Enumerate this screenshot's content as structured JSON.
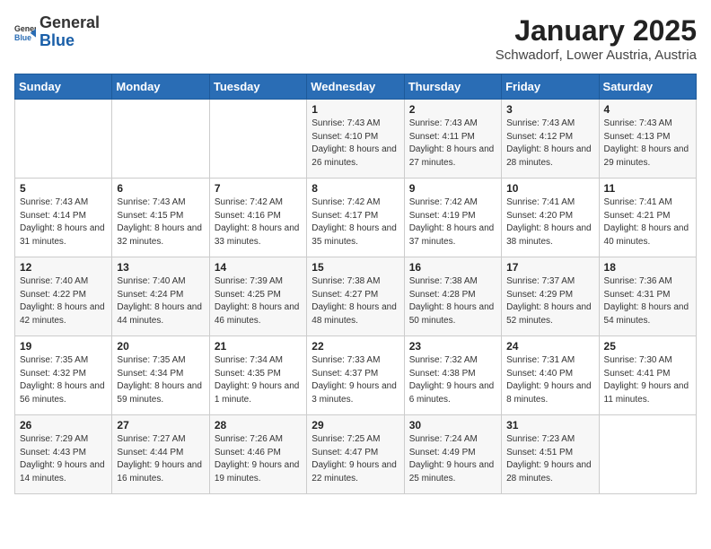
{
  "header": {
    "logo_general": "General",
    "logo_blue": "Blue",
    "month": "January 2025",
    "location": "Schwadorf, Lower Austria, Austria"
  },
  "days_of_week": [
    "Sunday",
    "Monday",
    "Tuesday",
    "Wednesday",
    "Thursday",
    "Friday",
    "Saturday"
  ],
  "weeks": [
    [
      {
        "day": "",
        "content": ""
      },
      {
        "day": "",
        "content": ""
      },
      {
        "day": "",
        "content": ""
      },
      {
        "day": "1",
        "content": "Sunrise: 7:43 AM\nSunset: 4:10 PM\nDaylight: 8 hours and 26 minutes."
      },
      {
        "day": "2",
        "content": "Sunrise: 7:43 AM\nSunset: 4:11 PM\nDaylight: 8 hours and 27 minutes."
      },
      {
        "day": "3",
        "content": "Sunrise: 7:43 AM\nSunset: 4:12 PM\nDaylight: 8 hours and 28 minutes."
      },
      {
        "day": "4",
        "content": "Sunrise: 7:43 AM\nSunset: 4:13 PM\nDaylight: 8 hours and 29 minutes."
      }
    ],
    [
      {
        "day": "5",
        "content": "Sunrise: 7:43 AM\nSunset: 4:14 PM\nDaylight: 8 hours and 31 minutes."
      },
      {
        "day": "6",
        "content": "Sunrise: 7:43 AM\nSunset: 4:15 PM\nDaylight: 8 hours and 32 minutes."
      },
      {
        "day": "7",
        "content": "Sunrise: 7:42 AM\nSunset: 4:16 PM\nDaylight: 8 hours and 33 minutes."
      },
      {
        "day": "8",
        "content": "Sunrise: 7:42 AM\nSunset: 4:17 PM\nDaylight: 8 hours and 35 minutes."
      },
      {
        "day": "9",
        "content": "Sunrise: 7:42 AM\nSunset: 4:19 PM\nDaylight: 8 hours and 37 minutes."
      },
      {
        "day": "10",
        "content": "Sunrise: 7:41 AM\nSunset: 4:20 PM\nDaylight: 8 hours and 38 minutes."
      },
      {
        "day": "11",
        "content": "Sunrise: 7:41 AM\nSunset: 4:21 PM\nDaylight: 8 hours and 40 minutes."
      }
    ],
    [
      {
        "day": "12",
        "content": "Sunrise: 7:40 AM\nSunset: 4:22 PM\nDaylight: 8 hours and 42 minutes."
      },
      {
        "day": "13",
        "content": "Sunrise: 7:40 AM\nSunset: 4:24 PM\nDaylight: 8 hours and 44 minutes."
      },
      {
        "day": "14",
        "content": "Sunrise: 7:39 AM\nSunset: 4:25 PM\nDaylight: 8 hours and 46 minutes."
      },
      {
        "day": "15",
        "content": "Sunrise: 7:38 AM\nSunset: 4:27 PM\nDaylight: 8 hours and 48 minutes."
      },
      {
        "day": "16",
        "content": "Sunrise: 7:38 AM\nSunset: 4:28 PM\nDaylight: 8 hours and 50 minutes."
      },
      {
        "day": "17",
        "content": "Sunrise: 7:37 AM\nSunset: 4:29 PM\nDaylight: 8 hours and 52 minutes."
      },
      {
        "day": "18",
        "content": "Sunrise: 7:36 AM\nSunset: 4:31 PM\nDaylight: 8 hours and 54 minutes."
      }
    ],
    [
      {
        "day": "19",
        "content": "Sunrise: 7:35 AM\nSunset: 4:32 PM\nDaylight: 8 hours and 56 minutes."
      },
      {
        "day": "20",
        "content": "Sunrise: 7:35 AM\nSunset: 4:34 PM\nDaylight: 8 hours and 59 minutes."
      },
      {
        "day": "21",
        "content": "Sunrise: 7:34 AM\nSunset: 4:35 PM\nDaylight: 9 hours and 1 minute."
      },
      {
        "day": "22",
        "content": "Sunrise: 7:33 AM\nSunset: 4:37 PM\nDaylight: 9 hours and 3 minutes."
      },
      {
        "day": "23",
        "content": "Sunrise: 7:32 AM\nSunset: 4:38 PM\nDaylight: 9 hours and 6 minutes."
      },
      {
        "day": "24",
        "content": "Sunrise: 7:31 AM\nSunset: 4:40 PM\nDaylight: 9 hours and 8 minutes."
      },
      {
        "day": "25",
        "content": "Sunrise: 7:30 AM\nSunset: 4:41 PM\nDaylight: 9 hours and 11 minutes."
      }
    ],
    [
      {
        "day": "26",
        "content": "Sunrise: 7:29 AM\nSunset: 4:43 PM\nDaylight: 9 hours and 14 minutes."
      },
      {
        "day": "27",
        "content": "Sunrise: 7:27 AM\nSunset: 4:44 PM\nDaylight: 9 hours and 16 minutes."
      },
      {
        "day": "28",
        "content": "Sunrise: 7:26 AM\nSunset: 4:46 PM\nDaylight: 9 hours and 19 minutes."
      },
      {
        "day": "29",
        "content": "Sunrise: 7:25 AM\nSunset: 4:47 PM\nDaylight: 9 hours and 22 minutes."
      },
      {
        "day": "30",
        "content": "Sunrise: 7:24 AM\nSunset: 4:49 PM\nDaylight: 9 hours and 25 minutes."
      },
      {
        "day": "31",
        "content": "Sunrise: 7:23 AM\nSunset: 4:51 PM\nDaylight: 9 hours and 28 minutes."
      },
      {
        "day": "",
        "content": ""
      }
    ]
  ]
}
